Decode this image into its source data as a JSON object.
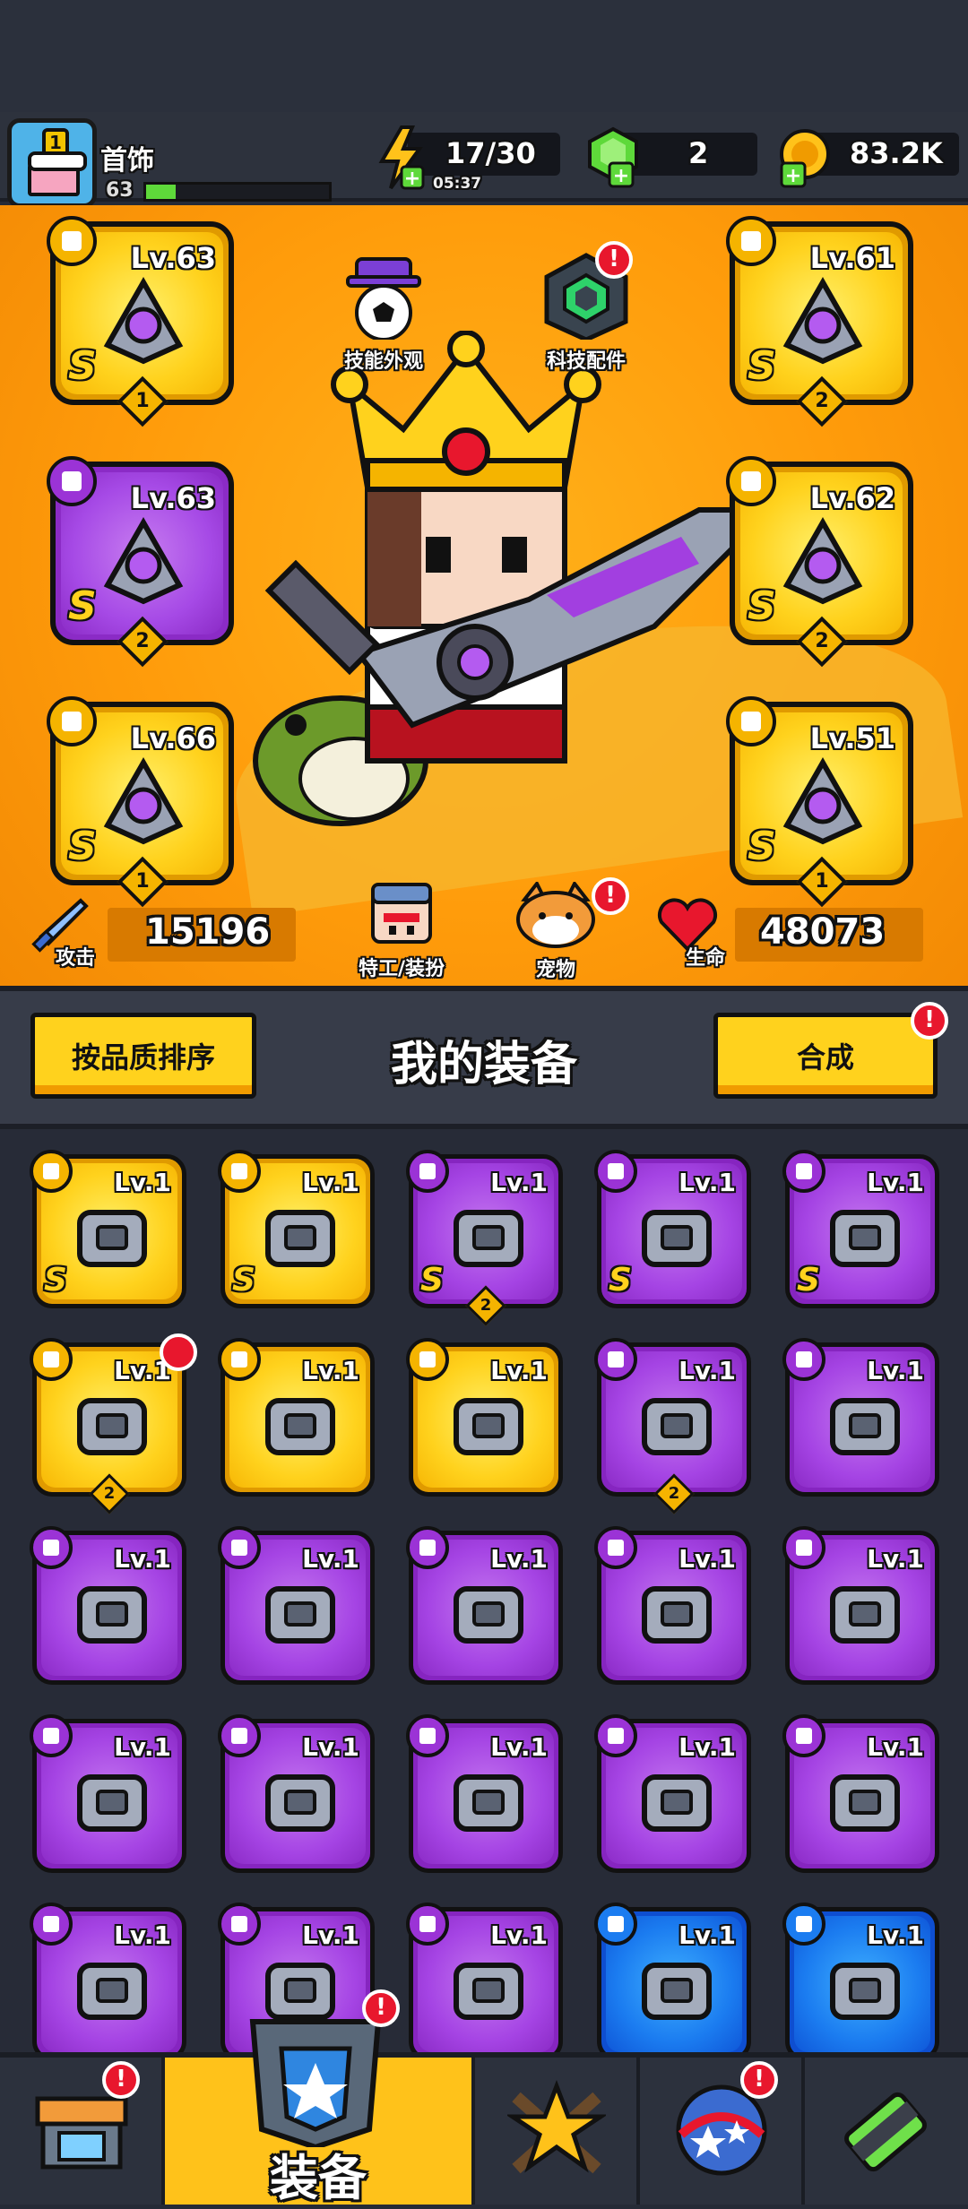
{
  "player": {
    "name": "首饰",
    "level": "63",
    "rank_badge": "1",
    "xp_fraction": 0.16
  },
  "resources": {
    "energy": "17/30",
    "energy_timer": "05:37",
    "gems": "2",
    "coins": "83.2K"
  },
  "hero": {
    "skill_skin_label": "技能外观",
    "tech_parts_label": "科技配件",
    "agent_label": "特工/装扮",
    "pet_label": "宠物",
    "attack_label": "攻击",
    "attack_value": "15196",
    "hp_label": "生命",
    "hp_value": "48073",
    "alert": "!"
  },
  "equipped_slots": [
    {
      "name": "weapon",
      "level": "Lv.63",
      "rank": "S",
      "stars": "1",
      "rarity": "gold"
    },
    {
      "name": "armor",
      "level": "Lv.61",
      "rank": "S",
      "stars": "2",
      "rarity": "gold"
    },
    {
      "name": "necklace",
      "level": "Lv.63",
      "rank": "S",
      "stars": "2",
      "rarity": "purple"
    },
    {
      "name": "belt",
      "level": "Lv.62",
      "rank": "S",
      "stars": "2",
      "rarity": "gold"
    },
    {
      "name": "gloves",
      "level": "Lv.66",
      "rank": "S",
      "stars": "1",
      "rarity": "gold"
    },
    {
      "name": "boots",
      "level": "Lv.51",
      "rank": "S",
      "stars": "1",
      "rarity": "gold"
    }
  ],
  "equipment_section": {
    "title": "我的装备",
    "sort_button": "按品质排序",
    "merge_button": "合成",
    "alert": "!"
  },
  "inventory": [
    {
      "level": "Lv.1",
      "rarity": "gold",
      "rank": "S",
      "badge": ""
    },
    {
      "level": "Lv.1",
      "rarity": "gold",
      "rank": "S",
      "badge": ""
    },
    {
      "level": "Lv.1",
      "rarity": "purple",
      "rank": "S",
      "badge": "2"
    },
    {
      "level": "Lv.1",
      "rarity": "purple",
      "rank": "S",
      "badge": ""
    },
    {
      "level": "Lv.1",
      "rarity": "purple",
      "rank": "S",
      "badge": ""
    },
    {
      "level": "Lv.1",
      "rarity": "gold",
      "rank": "",
      "badge": "2"
    },
    {
      "level": "Lv.1",
      "rarity": "gold",
      "rank": "",
      "badge": ""
    },
    {
      "level": "Lv.1",
      "rarity": "gold",
      "rank": "",
      "badge": ""
    },
    {
      "level": "Lv.1",
      "rarity": "purple",
      "rank": "",
      "badge": "2"
    },
    {
      "level": "Lv.1",
      "rarity": "purple",
      "rank": "",
      "badge": ""
    },
    {
      "level": "Lv.1",
      "rarity": "purple",
      "rank": "",
      "badge": ""
    },
    {
      "level": "Lv.1",
      "rarity": "purple",
      "rank": "",
      "badge": ""
    },
    {
      "level": "Lv.1",
      "rarity": "purple",
      "rank": "",
      "badge": ""
    },
    {
      "level": "Lv.1",
      "rarity": "purple",
      "rank": "",
      "badge": ""
    },
    {
      "level": "Lv.1",
      "rarity": "purple",
      "rank": "",
      "badge": ""
    },
    {
      "level": "Lv.1",
      "rarity": "purple",
      "rank": "",
      "badge": ""
    },
    {
      "level": "Lv.1",
      "rarity": "purple",
      "rank": "",
      "badge": ""
    },
    {
      "level": "Lv.1",
      "rarity": "purple",
      "rank": "",
      "badge": ""
    },
    {
      "level": "Lv.1",
      "rarity": "purple",
      "rank": "",
      "badge": ""
    },
    {
      "level": "Lv.1",
      "rarity": "purple",
      "rank": "",
      "badge": ""
    },
    {
      "level": "Lv.1",
      "rarity": "purple",
      "rank": "",
      "badge": ""
    },
    {
      "level": "Lv.1",
      "rarity": "purple",
      "rank": "",
      "badge": ""
    },
    {
      "level": "Lv.1",
      "rarity": "purple",
      "rank": "",
      "badge": ""
    },
    {
      "level": "Lv.1",
      "rarity": "blue",
      "rank": "",
      "badge": ""
    },
    {
      "level": "Lv.1",
      "rarity": "blue",
      "rank": "",
      "badge": ""
    }
  ],
  "bottom_nav": {
    "active_label": "装备",
    "tabs": [
      "shop-icon",
      "equipment-icon",
      "talent-star-icon",
      "event-ball-icon",
      "gene-capsule-icon"
    ]
  },
  "colors": {
    "gold": "#ffd21d",
    "purple": "#a544e4",
    "blue": "#1b7cf0",
    "hero_bg": "#ff9c0b",
    "alert": "#e8172d"
  }
}
